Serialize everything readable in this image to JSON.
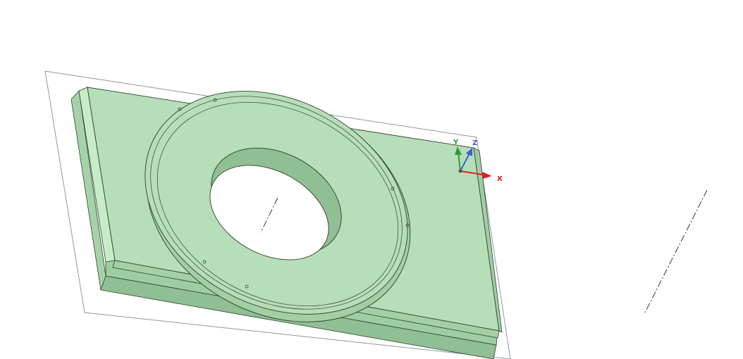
{
  "viewport": {
    "background": "#ffffff",
    "part_color": "#b6deb8",
    "part_edge_color": "#2f3f31",
    "part_shadow_color": "#8fbf92",
    "plane_color": "#8a9aa0",
    "axis_line_color": "#333333"
  },
  "triad": {
    "x_label": "X",
    "y_label": "Y",
    "z_label": "Z",
    "x_color": "#e02020",
    "y_color": "#2f9a3a",
    "z_color": "#3c5fd6"
  }
}
